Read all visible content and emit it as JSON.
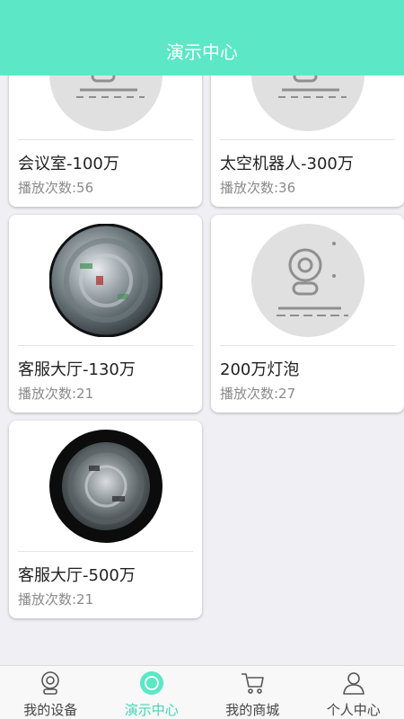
{
  "header": {
    "title": "演示中心"
  },
  "devices": [
    {
      "name": "会议室-100万",
      "plays": "播放次数:56",
      "thumb": "camera-placeholder"
    },
    {
      "name": "太空机器人-300万",
      "plays": "播放次数:36",
      "thumb": "camera-placeholder"
    },
    {
      "name": "客服大厅-130万",
      "plays": "播放次数:21",
      "thumb": "fisheye-snapshot"
    },
    {
      "name": "200万灯泡",
      "plays": "播放次数:27",
      "thumb": "camera-placeholder"
    },
    {
      "name": "客服大厅-500万",
      "plays": "播放次数:21",
      "thumb": "fisheye-snapshot-dark"
    }
  ],
  "tabbar": {
    "tabs": [
      {
        "label": "我的设备",
        "icon": "device-icon"
      },
      {
        "label": "演示中心",
        "icon": "demo-center-icon",
        "active": true
      },
      {
        "label": "我的商城",
        "icon": "cart-icon"
      },
      {
        "label": "个人中心",
        "icon": "person-icon"
      }
    ]
  },
  "colors": {
    "accent": "#5ce7c6",
    "active_tab": "#44d4b4",
    "background": "#efeff4"
  }
}
